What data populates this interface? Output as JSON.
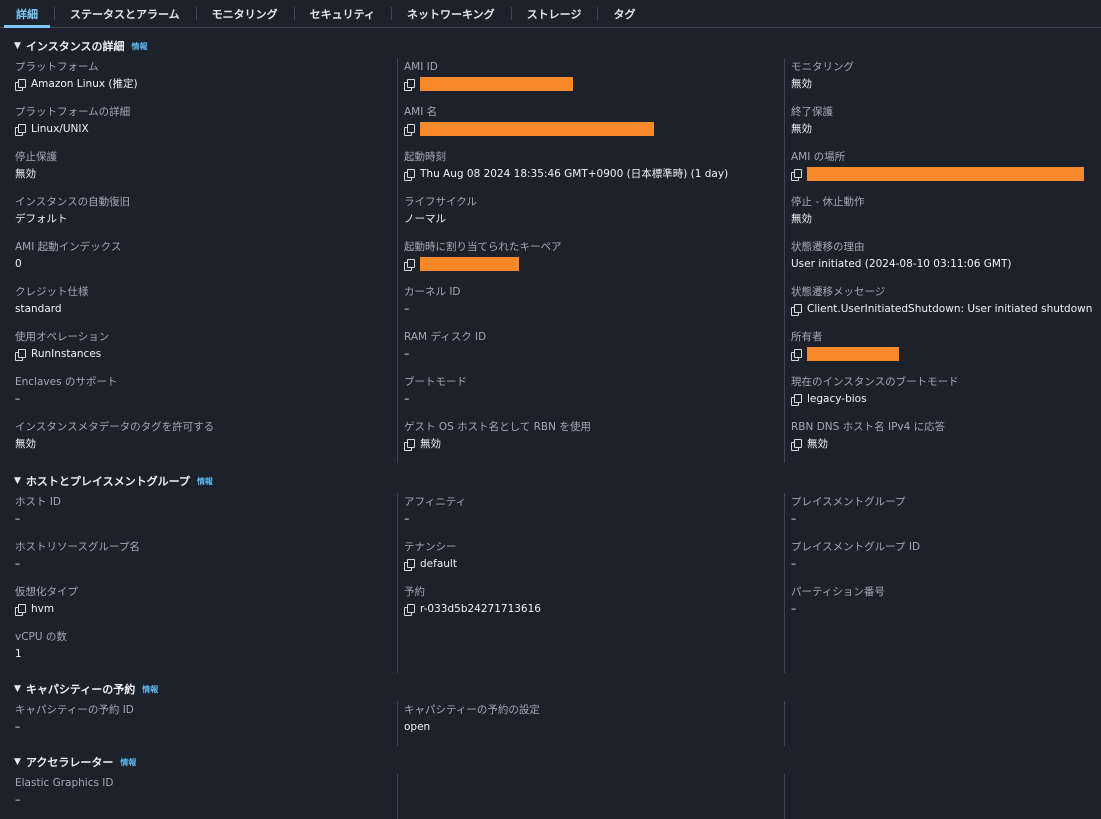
{
  "tabs": [
    "詳細",
    "ステータスとアラーム",
    "モニタリング",
    "セキュリティ",
    "ネットワーキング",
    "ストレージ",
    "タグ"
  ],
  "active_tab": "詳細",
  "info_label": "情報",
  "dash": "–",
  "sections": {
    "instance": {
      "title": "インスタンスの詳細",
      "col1": [
        {
          "label": "プラットフォーム",
          "value": "Amazon Linux (推定)",
          "copy": true
        },
        {
          "label": "プラットフォームの詳細",
          "value": "Linux/UNIX",
          "copy": true
        },
        {
          "label": "停止保護",
          "value": "無効"
        },
        {
          "label": "インスタンスの自動復旧",
          "value": "デフォルト"
        },
        {
          "label": "AMI 起動インデックス",
          "value": "0"
        },
        {
          "label": "クレジット仕様",
          "value": "standard"
        },
        {
          "label": "使用オペレーション",
          "value": "RunInstances",
          "copy": true
        },
        {
          "label": "Enclaves のサポート",
          "value": "–"
        },
        {
          "label": "インスタンスメタデータのタグを許可する",
          "value": "無効"
        }
      ],
      "col2": [
        {
          "label": "AMI ID",
          "value": "",
          "copy": true,
          "redacted": true
        },
        {
          "label": "AMI 名",
          "value": "",
          "copy": true,
          "redacted": true
        },
        {
          "label": "起動時刻",
          "value": "Thu Aug 08 2024 18:35:46 GMT+0900 (日本標準時) (1 day)",
          "copy": true
        },
        {
          "label": "ライフサイクル",
          "value": "ノーマル"
        },
        {
          "label": "起動時に割り当てられたキーペア",
          "value": "",
          "copy": true,
          "redacted": true
        },
        {
          "label": "カーネル ID",
          "value": "–"
        },
        {
          "label": "RAM ディスク ID",
          "value": "–"
        },
        {
          "label": "ブートモード",
          "value": "–"
        },
        {
          "label": "ゲスト OS ホスト名として RBN を使用",
          "value": "無効",
          "copy": true
        }
      ],
      "col3": [
        {
          "label": "モニタリング",
          "value": "無効"
        },
        {
          "label": "終了保護",
          "value": "無効"
        },
        {
          "label": "AMI の場所",
          "value": "",
          "copy": true,
          "redacted": true
        },
        {
          "label": "停止 - 休止動作",
          "value": "無効"
        },
        {
          "label": "状態遷移の理由",
          "value": "User initiated (2024-08-10 03:11:06 GMT)"
        },
        {
          "label": "状態遷移メッセージ",
          "value": "Client.UserInitiatedShutdown: User initiated shutdown",
          "copy": true
        },
        {
          "label": "所有者",
          "value": "",
          "copy": true,
          "redacted": true
        },
        {
          "label": "現在のインスタンスのブートモード",
          "value": "legacy-bios",
          "copy": true
        },
        {
          "label": "RBN DNS ホスト名 IPv4 に応答",
          "value": "無効",
          "copy": true
        }
      ]
    },
    "host": {
      "title": "ホストとプレイスメントグループ",
      "col1": [
        {
          "label": "ホスト ID",
          "value": "–"
        },
        {
          "label": "ホストリソースグループ名",
          "value": "–"
        },
        {
          "label": "仮想化タイプ",
          "value": "hvm",
          "copy": true
        },
        {
          "label": "vCPU の数",
          "value": "1"
        }
      ],
      "col2": [
        {
          "label": "アフィニティ",
          "value": "–"
        },
        {
          "label": "テナンシー",
          "value": "default",
          "copy": true
        },
        {
          "label": "予約",
          "value": "r-033d5b24271713616",
          "copy": true
        }
      ],
      "col3": [
        {
          "label": "プレイスメントグループ",
          "value": "–"
        },
        {
          "label": "プレイスメントグループ ID",
          "value": "–"
        },
        {
          "label": "パーティション番号",
          "value": "–"
        }
      ]
    },
    "capacity": {
      "title": "キャパシティーの予約",
      "col1": [
        {
          "label": "キャパシティーの予約 ID",
          "value": "–"
        }
      ],
      "col2": [
        {
          "label": "キャパシティーの予約の設定",
          "value": "open"
        }
      ],
      "col3": []
    },
    "accel": {
      "title": "アクセラレーター",
      "col1": [
        {
          "label": "Elastic Graphics ID",
          "value": "–"
        }
      ],
      "col2": [],
      "col3": []
    }
  },
  "colors": {
    "background": "#1b222c",
    "accent": "#7ec8f7",
    "redaction": "#f7892b"
  }
}
